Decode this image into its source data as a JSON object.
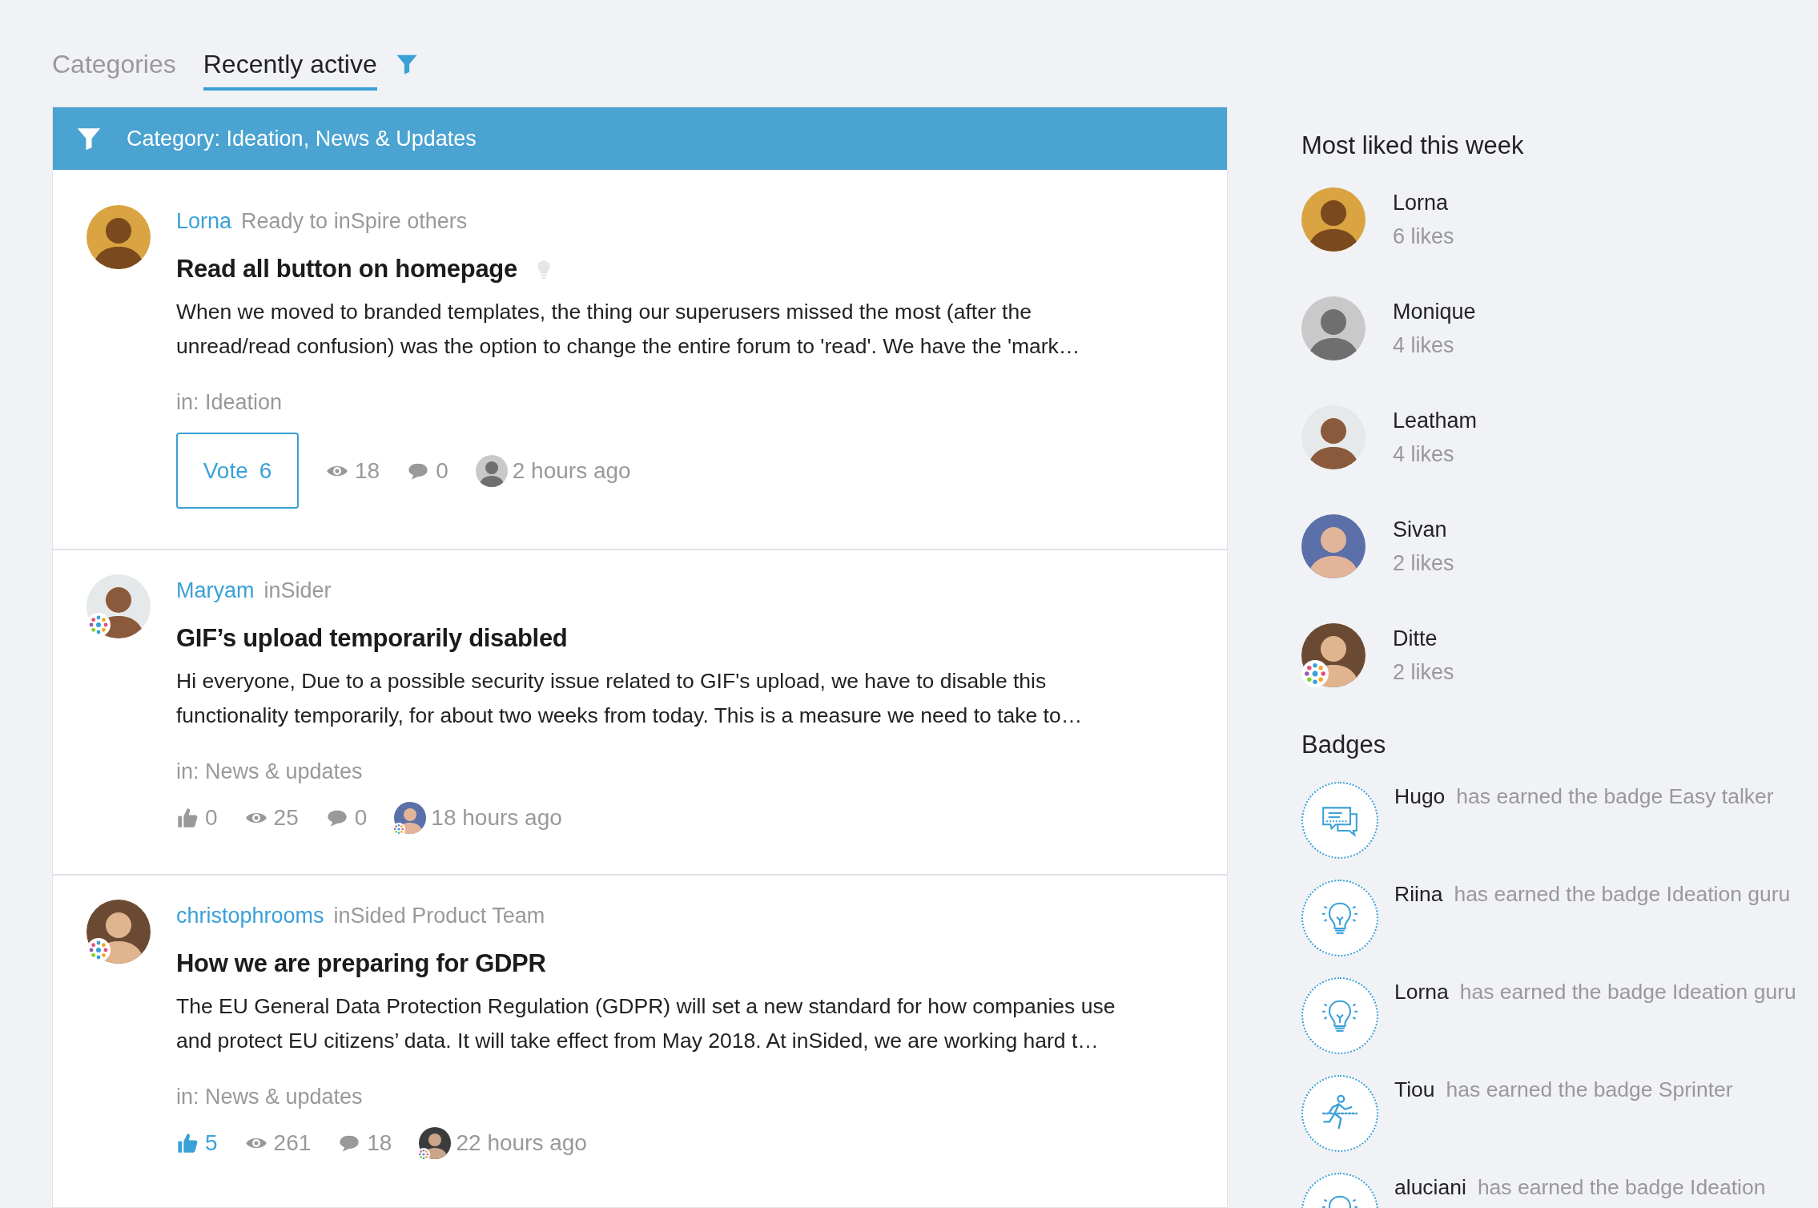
{
  "tabs": [
    {
      "label": "Categories",
      "selected": false
    },
    {
      "label": "Recently active",
      "selected": true
    }
  ],
  "filter_banner": {
    "label": "Category: Ideation, News & Updates"
  },
  "topics": [
    {
      "kind": "idea",
      "author": "Lorna",
      "author_badge": false,
      "role": "Ready to inSpire others",
      "title": "Read all button on homepage",
      "body_lines": [
        "When we moved to branded templates, the thing our superusers missed the most (after the",
        "unread/read confusion) was the option to change the entire forum to 'read'. We have the 'mark…"
      ],
      "category": "in: Ideation",
      "vote_label": "Vote",
      "votes": "6",
      "views": "18",
      "comments": "0",
      "time": "2 hours ago"
    },
    {
      "kind": "article",
      "author": "Maryam",
      "author_badge": true,
      "role": "inSider",
      "title": "GIF’s upload temporarily disabled",
      "body_lines": [
        "Hi everyone, Due to a possible security issue related to GIF's upload, we have to disable this",
        "functionality temporarily, for about two weeks from today. This is a measure we need to take to…"
      ],
      "category": "in: News & updates",
      "likes": "0",
      "liked": false,
      "views": "25",
      "comments": "0",
      "time": "18 hours ago"
    },
    {
      "kind": "article",
      "author": "christophrooms",
      "author_badge": true,
      "role": "inSided Product Team",
      "title": "How we are preparing for GDPR",
      "body_lines": [
        "The EU General Data Protection Regulation (GDPR) will set a new standard for how companies use",
        "and protect EU citizens’ data. It will take effect from May 2018. At inSided, we are working hard t…"
      ],
      "category": "in: News & updates",
      "likes": "5",
      "liked": true,
      "views": "261",
      "comments": "18",
      "time": "22 hours ago"
    }
  ],
  "most_liked": {
    "title": "Most liked this week",
    "users": [
      {
        "name": "Lorna",
        "likes": "6 likes",
        "badge": false
      },
      {
        "name": "Monique",
        "likes": "4 likes",
        "badge": false
      },
      {
        "name": "Leatham",
        "likes": "4 likes",
        "badge": false
      },
      {
        "name": "Sivan",
        "likes": "2 likes",
        "badge": false
      },
      {
        "name": "Ditte",
        "likes": "2 likes",
        "badge": true
      }
    ]
  },
  "badges": {
    "title": "Badges",
    "items": [
      {
        "kind": "talker",
        "user": "Hugo",
        "text": "has earned the badge Easy talker"
      },
      {
        "kind": "idea",
        "user": "Riina",
        "text": "has earned the badge Ideation guru"
      },
      {
        "kind": "idea",
        "user": "Lorna",
        "text": "has earned the badge Ideation guru"
      },
      {
        "kind": "sprinter",
        "user": "Tiou",
        "text": "has earned the badge Sprinter"
      },
      {
        "kind": "idea",
        "user": "aluciani",
        "text": "has earned the badge Ideation"
      }
    ]
  }
}
